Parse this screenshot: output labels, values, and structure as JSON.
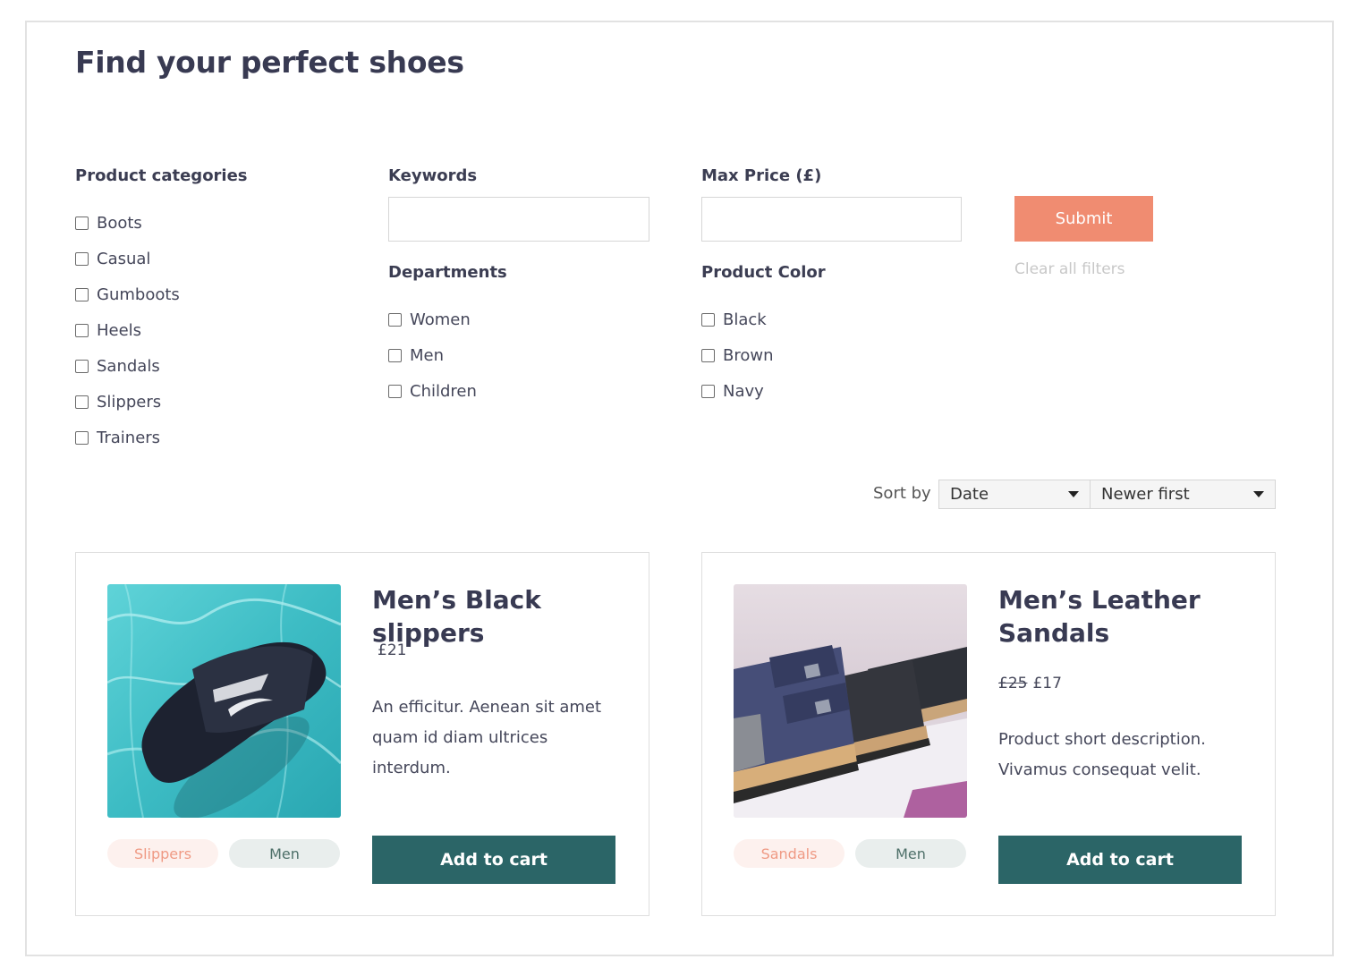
{
  "page": {
    "title": "Find your perfect shoes"
  },
  "filters": {
    "categories": {
      "label": "Product categories",
      "items": [
        "Boots",
        "Casual",
        "Gumboots",
        "Heels",
        "Sandals",
        "Slippers",
        "Trainers"
      ]
    },
    "keywords": {
      "label": "Keywords",
      "value": "",
      "placeholder": ""
    },
    "max_price": {
      "label": "Max Price (£)",
      "value": "",
      "placeholder": ""
    },
    "departments": {
      "label": "Departments",
      "items": [
        "Women",
        "Men",
        "Children"
      ]
    },
    "colors": {
      "label": "Product Color",
      "items": [
        "Black",
        "Brown",
        "Navy"
      ]
    },
    "submit_label": "Submit",
    "clear_label": "Clear all filters"
  },
  "sort": {
    "label": "Sort by",
    "field_value": "Date",
    "order_value": "Newer first"
  },
  "products": [
    {
      "title": "Men’s Black slippers",
      "old_price": "",
      "price": "£21",
      "description": "An efficitur. Aenean sit amet quam id diam ultrices interdum.",
      "category_tag": "Slippers",
      "department_tag": "Men",
      "cart_label": "Add to cart"
    },
    {
      "title": "Men’s Leather Sandals",
      "old_price": "£25",
      "price": "£17",
      "description": "Product short description. Vivamus consequat velit.",
      "category_tag": "Sandals",
      "department_tag": "Men",
      "cart_label": "Add to cart"
    }
  ],
  "colors": {
    "accent": "#f08c71",
    "primary": "#2b6567",
    "heading": "#383a52"
  }
}
